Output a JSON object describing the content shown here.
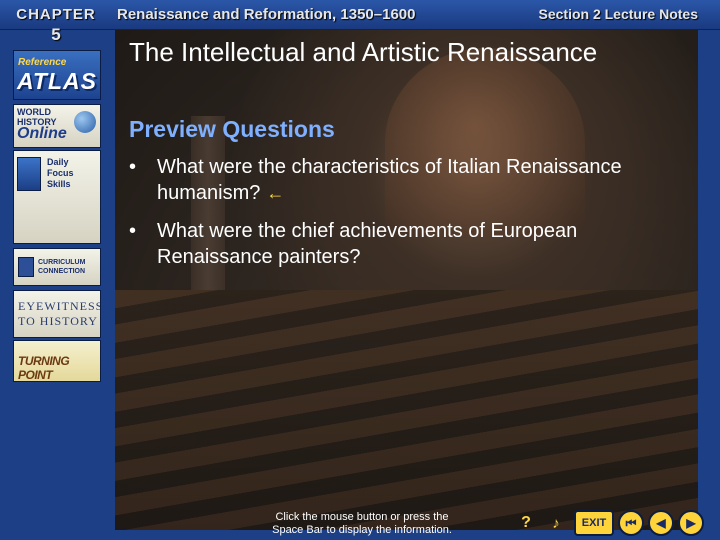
{
  "header": {
    "chapter_word": "CHAPTER",
    "chapter_number": "5",
    "book_title": "Renaissance and Reformation, 1350–1600",
    "section_label": "Section 2 Lecture Notes"
  },
  "sidebar": {
    "reference_atlas": {
      "small": "Reference",
      "large": "ATLAS"
    },
    "world_history_online": {
      "line1": "WORLD",
      "line2": "HISTORY",
      "line3": "Online"
    },
    "daily_focus_skills": {
      "line1": "Daily",
      "line2": "Focus",
      "line3": "Skills"
    },
    "curriculum_connection": {
      "line1": "CURRICULUM",
      "line2": "CONNECTION"
    },
    "eyewitness_to_history": {
      "line1": "EYEWITNESS",
      "line2": "TO HISTORY"
    },
    "turning_point": {
      "label": "TURNING POINT"
    }
  },
  "slide": {
    "title": "The Intellectual and Artistic Renaissance",
    "subtitle": "Preview Questions",
    "questions": [
      {
        "bullet": "•",
        "text": "What were the characteristics of Italian Renaissance humanism?",
        "arrow": "←"
      },
      {
        "bullet": "•",
        "text": "What were the chief achievements of European Renaissance painters?"
      }
    ],
    "instruction": "Click the mouse button or press the Space Bar to display the information."
  },
  "controls": {
    "help_glyph": "?",
    "sound_glyph": "♪",
    "exit_label": "EXIT",
    "first_glyph": "⏮",
    "prev_glyph": "◀",
    "next_glyph": "▶"
  },
  "colors": {
    "background": "#1c3f86",
    "subtitle": "#7fb0ff",
    "accent_yellow": "#ffd33a"
  }
}
